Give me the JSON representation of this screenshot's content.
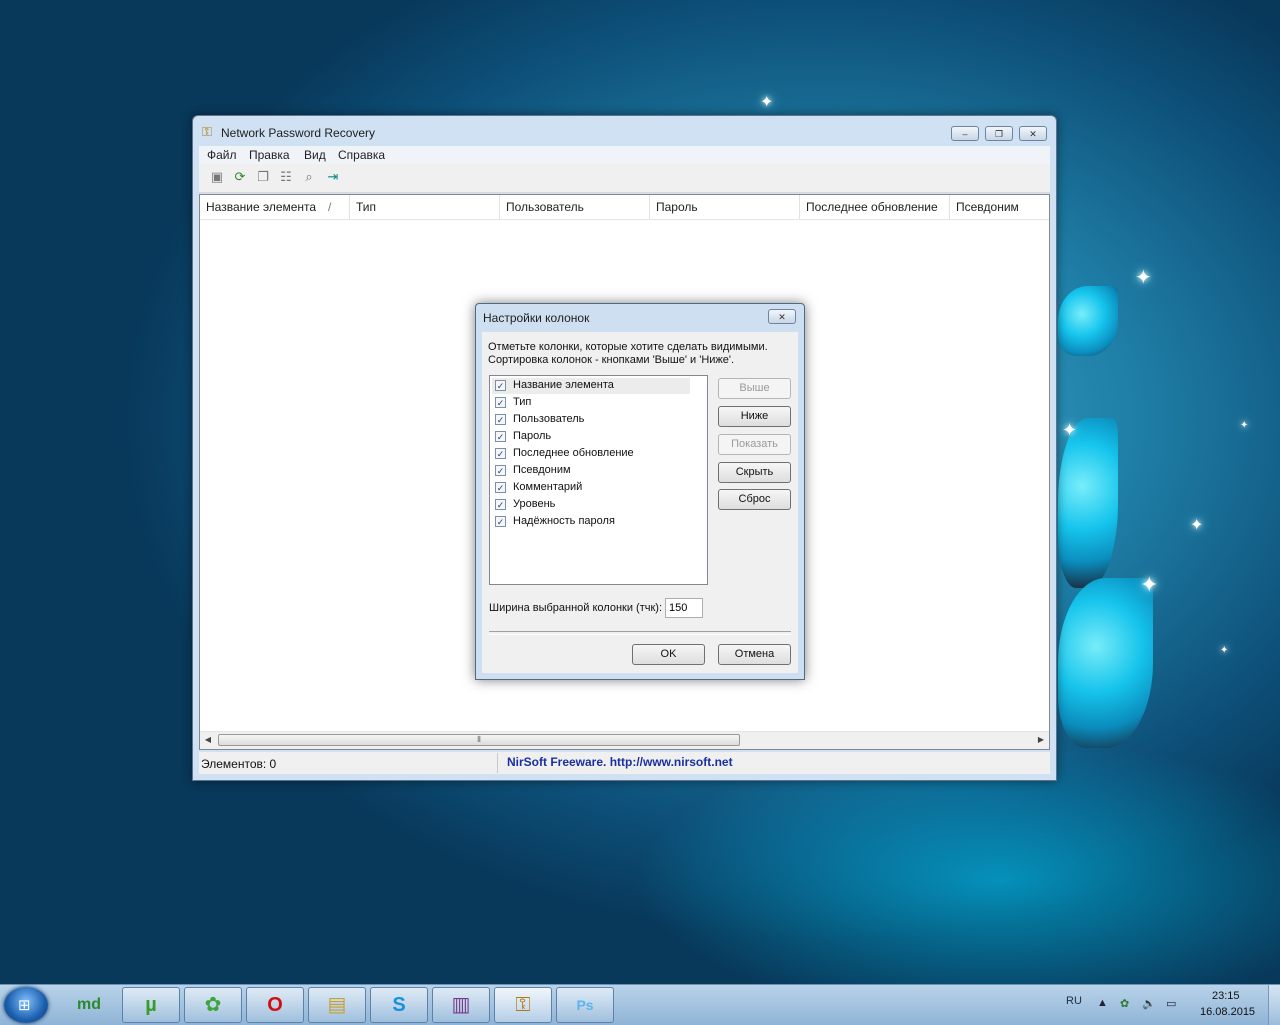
{
  "main_window": {
    "title": "Network Password Recovery",
    "controls": {
      "minimize": "–",
      "maximize": "❐",
      "close": "✕"
    },
    "menu": [
      "Файл",
      "Правка",
      "Вид",
      "Справка"
    ],
    "toolbar_icons": [
      "save-icon",
      "refresh-icon",
      "copy-icon",
      "properties-icon",
      "find-icon",
      "exit-icon"
    ],
    "columns": [
      "Название элемента",
      "Тип",
      "Пользователь",
      "Пароль",
      "Последнее обновление",
      "Псевдоним"
    ],
    "sort_indicator": "/",
    "status": {
      "count": "Элементов: 0",
      "link": "NirSoft Freeware.  http://www.nirsoft.net"
    }
  },
  "dialog": {
    "title": "Настройки колонок",
    "hint_line1": "Отметьте колонки, которые хотите сделать видимыми.",
    "hint_line2": "Сортировка колонок - кнопками 'Выше' и 'Ниже'.",
    "columns": [
      {
        "label": "Название элемента",
        "checked": true
      },
      {
        "label": "Тип",
        "checked": true
      },
      {
        "label": "Пользователь",
        "checked": true
      },
      {
        "label": "Пароль",
        "checked": true
      },
      {
        "label": "Последнее обновление",
        "checked": true
      },
      {
        "label": "Псевдоним",
        "checked": true
      },
      {
        "label": "Комментарий",
        "checked": true
      },
      {
        "label": "Уровень",
        "checked": true
      },
      {
        "label": "Надёжность пароля",
        "checked": true
      }
    ],
    "buttons": {
      "up": "Выше",
      "down": "Ниже",
      "show": "Показать",
      "hide": "Скрыть",
      "reset": "Сброс"
    },
    "width_label": "Ширина выбранной колонки (тчк):",
    "width_value": "150",
    "ok": "OK",
    "cancel": "Отмена"
  },
  "taskbar": {
    "apps": [
      "mediaget",
      "utorrent",
      "icq",
      "opera",
      "explorer",
      "skype",
      "winrar",
      "network-password-recovery",
      "photoshop"
    ],
    "app_glyphs": {
      "mediaget": "md",
      "utorrent": "µ",
      "icq": "✿",
      "opera": "O",
      "explorer": "▤",
      "skype": "S",
      "winrar": "▥",
      "network-password-recovery": "⚿",
      "photoshop": "Ps"
    },
    "language": "RU",
    "time": "23:15",
    "date": "16.08.2015"
  }
}
